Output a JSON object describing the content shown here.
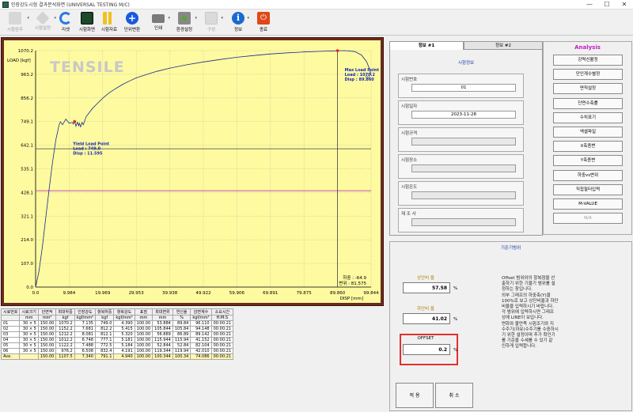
{
  "window": {
    "title": "인장강도시험 결과분석화면 (UNIVERSAL TESTING M/C)",
    "controls": [
      "—",
      "☐",
      "✕"
    ]
  },
  "toolbar": {
    "items": [
      {
        "label": "시험완주",
        "icon": "test-run-icon",
        "enabled": false
      },
      {
        "label": "시험설정",
        "icon": "test-setup-icon",
        "enabled": false
      },
      {
        "label": "리셋",
        "icon": "reset-icon",
        "enabled": true
      },
      {
        "label": "시험화면",
        "icon": "test-screen-icon",
        "enabled": true
      },
      {
        "label": "시험자료",
        "icon": "test-data-icon",
        "enabled": true
      },
      {
        "label": "단위변환",
        "icon": "unit-convert-icon",
        "enabled": true
      },
      {
        "label": "인쇄",
        "icon": "print-icon",
        "enabled": true
      },
      {
        "label": "환경설정",
        "icon": "settings-icon",
        "enabled": true
      },
      {
        "label": "구성",
        "icon": "config-icon",
        "enabled": false
      },
      {
        "label": "정보",
        "icon": "info-icon",
        "enabled": true
      },
      {
        "label": "종료",
        "icon": "exit-icon",
        "enabled": true
      }
    ]
  },
  "chart_data": {
    "type": "line",
    "watermark": "TENSILE",
    "ylabel": "LOAD [kgf]",
    "xlabel": "DISP [mm]",
    "xlim": [
      0.0,
      99.844
    ],
    "ylim": [
      0.0,
      1070.2
    ],
    "xticks": [
      "0.0",
      "9.984",
      "19.969",
      "29.953",
      "39.938",
      "49.922",
      "59.906",
      "69.891",
      "79.875",
      "89.860",
      "99.844"
    ],
    "yticks": [
      "0.0",
      "107.0",
      "214.0",
      "321.1",
      "428.1",
      "535.1",
      "642.1",
      "749.1",
      "856.2",
      "963.2",
      "1070.2"
    ],
    "colors": {
      "curve": "#1a2a8a",
      "plot_bg": "#fdfaa0",
      "frame": "#6a2a1e",
      "hline": "#c038c0",
      "marker": "#e02020",
      "annotation": "#1a2ab0"
    },
    "hlines": [
      436.0,
      626.0
    ],
    "vlines": [
      89.86
    ],
    "series": [
      {
        "x": [
          0.0,
          1.0,
          2.0,
          3.0,
          4.0,
          5.0,
          6.0,
          7.0,
          7.4,
          8.0,
          9.0,
          10.0,
          11.0,
          11.2,
          11.6,
          12.0,
          12.4,
          12.8,
          13.0,
          13.4,
          13.8,
          14.2,
          15.0,
          16.0,
          17.0,
          18.0,
          20.0,
          22.0,
          24.0,
          26.0,
          28.0,
          30.0,
          33.0,
          36.0,
          40.0,
          45.0,
          50.0,
          55.0,
          60.0,
          65.0,
          70.0,
          75.0,
          80.0,
          85.0,
          89.0,
          92.0,
          95.0,
          97.0,
          98.5,
          99.3,
          99.844
        ],
        "values": [
          0.0,
          70.0,
          180.0,
          310.0,
          440.0,
          560.0,
          665.0,
          735.0,
          748.0,
          735.0,
          760.0,
          742.0,
          745.0,
          738.0,
          750.0,
          728.0,
          746.0,
          730.0,
          742.0,
          725.0,
          745.0,
          735.0,
          770.0,
          790.0,
          810.0,
          825.0,
          855.0,
          880.0,
          900.0,
          918.0,
          933.0,
          947.0,
          962.0,
          976.0,
          991.0,
          1006.0,
          1019.0,
          1030.0,
          1040.0,
          1048.0,
          1055.0,
          1060.0,
          1064.0,
          1067.0,
          1069.0,
          1070.2,
          1066.0,
          1050.0,
          1020.0,
          990.0,
          960.0
        ]
      }
    ],
    "markers": [
      {
        "x": 11.595,
        "y": 749.1
      },
      {
        "x": 89.86,
        "y": 1070.2
      }
    ],
    "annotations": {
      "yield": [
        "Yield Load Point",
        "Load : 749.0",
        "Disp : 11.595"
      ],
      "max": [
        "Max Load Point",
        "Load : 1070.2",
        "Disp : 89.860"
      ],
      "curve_label": "01",
      "info": [
        "하중 : -64.9",
        "변위 : 81.575"
      ]
    }
  },
  "results_table": {
    "headers": [
      "시료번호",
      "시료크기",
      "단면적",
      "최대하중",
      "인장강도",
      "항복하중",
      "항복강도",
      "표점",
      "최대변위",
      "연신율",
      "감면계수",
      "소요시간"
    ],
    "units": [
      "",
      "mm",
      "mm²",
      "kgf",
      "kgf/mm²",
      "kgf",
      "kgf/mm²",
      "mm",
      "mm",
      "%",
      "kgf/mm²",
      "H:M:S"
    ],
    "rows": [
      [
        "01",
        "30 × 5",
        "150.00",
        "1070.2",
        "7.135",
        "749.0",
        "4.390",
        "100.00",
        "53.884",
        "89.84",
        "96.110",
        "00:00:21"
      ],
      [
        "02",
        "30 × 5",
        "150.00",
        "1152.2",
        "7.681",
        "812.2",
        "5.415",
        "100.00",
        "105.844",
        "105.84",
        "94.148",
        "00:00:21"
      ],
      [
        "03",
        "30 × 5",
        "150.00",
        "1212.2",
        "8.081",
        "812.1",
        "5.320",
        "100.00",
        "56.889",
        "86.89",
        "89.142",
        "00:00:21"
      ],
      [
        "04",
        "30 × 5",
        "150.00",
        "1012.2",
        "6.748",
        "777.1",
        "5.181",
        "100.00",
        "115.944",
        "115.94",
        "41.152",
        "00:00:21"
      ],
      [
        "05",
        "30 × 5",
        "150.00",
        "1122.2",
        "7.488",
        "772.5",
        "5.184",
        "100.00",
        "52.844",
        "52.84",
        "82.104",
        "00:00:21"
      ],
      [
        "06",
        "30 × 5",
        "150.00",
        "976.2",
        "6.508",
        "832.4",
        "4.191",
        "100.00",
        "119.344",
        "119.94",
        "42.010",
        "00:00:21"
      ]
    ],
    "avg": [
      "Ave.",
      "",
      "150.00",
      "1107.5",
      "7.340",
      "791.1",
      "4.940",
      "100.00",
      "100.344",
      "100.34",
      "74.086",
      "00:00:21"
    ]
  },
  "info_tabs": {
    "tabs": [
      "정보 #1",
      "정보 #2"
    ],
    "active": 0,
    "title": "시험정보",
    "fields": [
      {
        "label": "시험번호",
        "value": "01"
      },
      {
        "label": "시험일자",
        "value": "2023-11-28"
      },
      {
        "label": "시험규격",
        "value": ""
      },
      {
        "label": "시험장소",
        "value": ""
      },
      {
        "label": "시험온도",
        "value": ""
      },
      {
        "label": "재 조 사",
        "value": ""
      }
    ]
  },
  "analysis": {
    "title": "Analysis",
    "buttons": [
      {
        "label": "강력신활정",
        "enabled": true
      },
      {
        "label": "단인계수별정",
        "enabled": true
      },
      {
        "label": "면적설정",
        "enabled": true
      },
      {
        "label": "단면수축률",
        "enabled": true
      },
      {
        "label": "수치표기",
        "enabled": true
      },
      {
        "label": "엑셀파일",
        "enabled": true
      },
      {
        "label": "X축종변",
        "enabled": true
      },
      {
        "label": "Y축종변",
        "enabled": true
      },
      {
        "label": "하중vs변위",
        "enabled": true
      },
      {
        "label": "직접필터입력",
        "enabled": true
      },
      {
        "label": "M-VALUE",
        "enabled": true
      },
      {
        "label": "N/A",
        "enabled": false
      }
    ]
  },
  "criteria": {
    "title": "기준기범위",
    "upper_label": "상단비 율",
    "upper_value": "57.58",
    "lower_label": "하단비 율",
    "lower_value": "41.02",
    "offset_label": "OFFSET",
    "offset_value": "0.2",
    "unit": "%",
    "note": "Offset 범위와의 항복점을 산\n출하기 위한 기울기 범위를 설\n정하는 창입니다.\n외부 그래프의 하중축(Y)을\n100%로 보고 상단비율과 하단\n비율을 입력하시기 바랍니다.\n각 범위에 입력하시면 그래프\n상에 LINE이 보입니다.\n면화와 불만족 시험조기와 지\n수주기(하유)수주기를 수중하시\n기 위한 설정이며 추가 확인기\n를 기준을 수세를 수 있기 같\n인하게 입력합니다.",
    "apply_label": "적 용",
    "cancel_label": "취 소"
  }
}
